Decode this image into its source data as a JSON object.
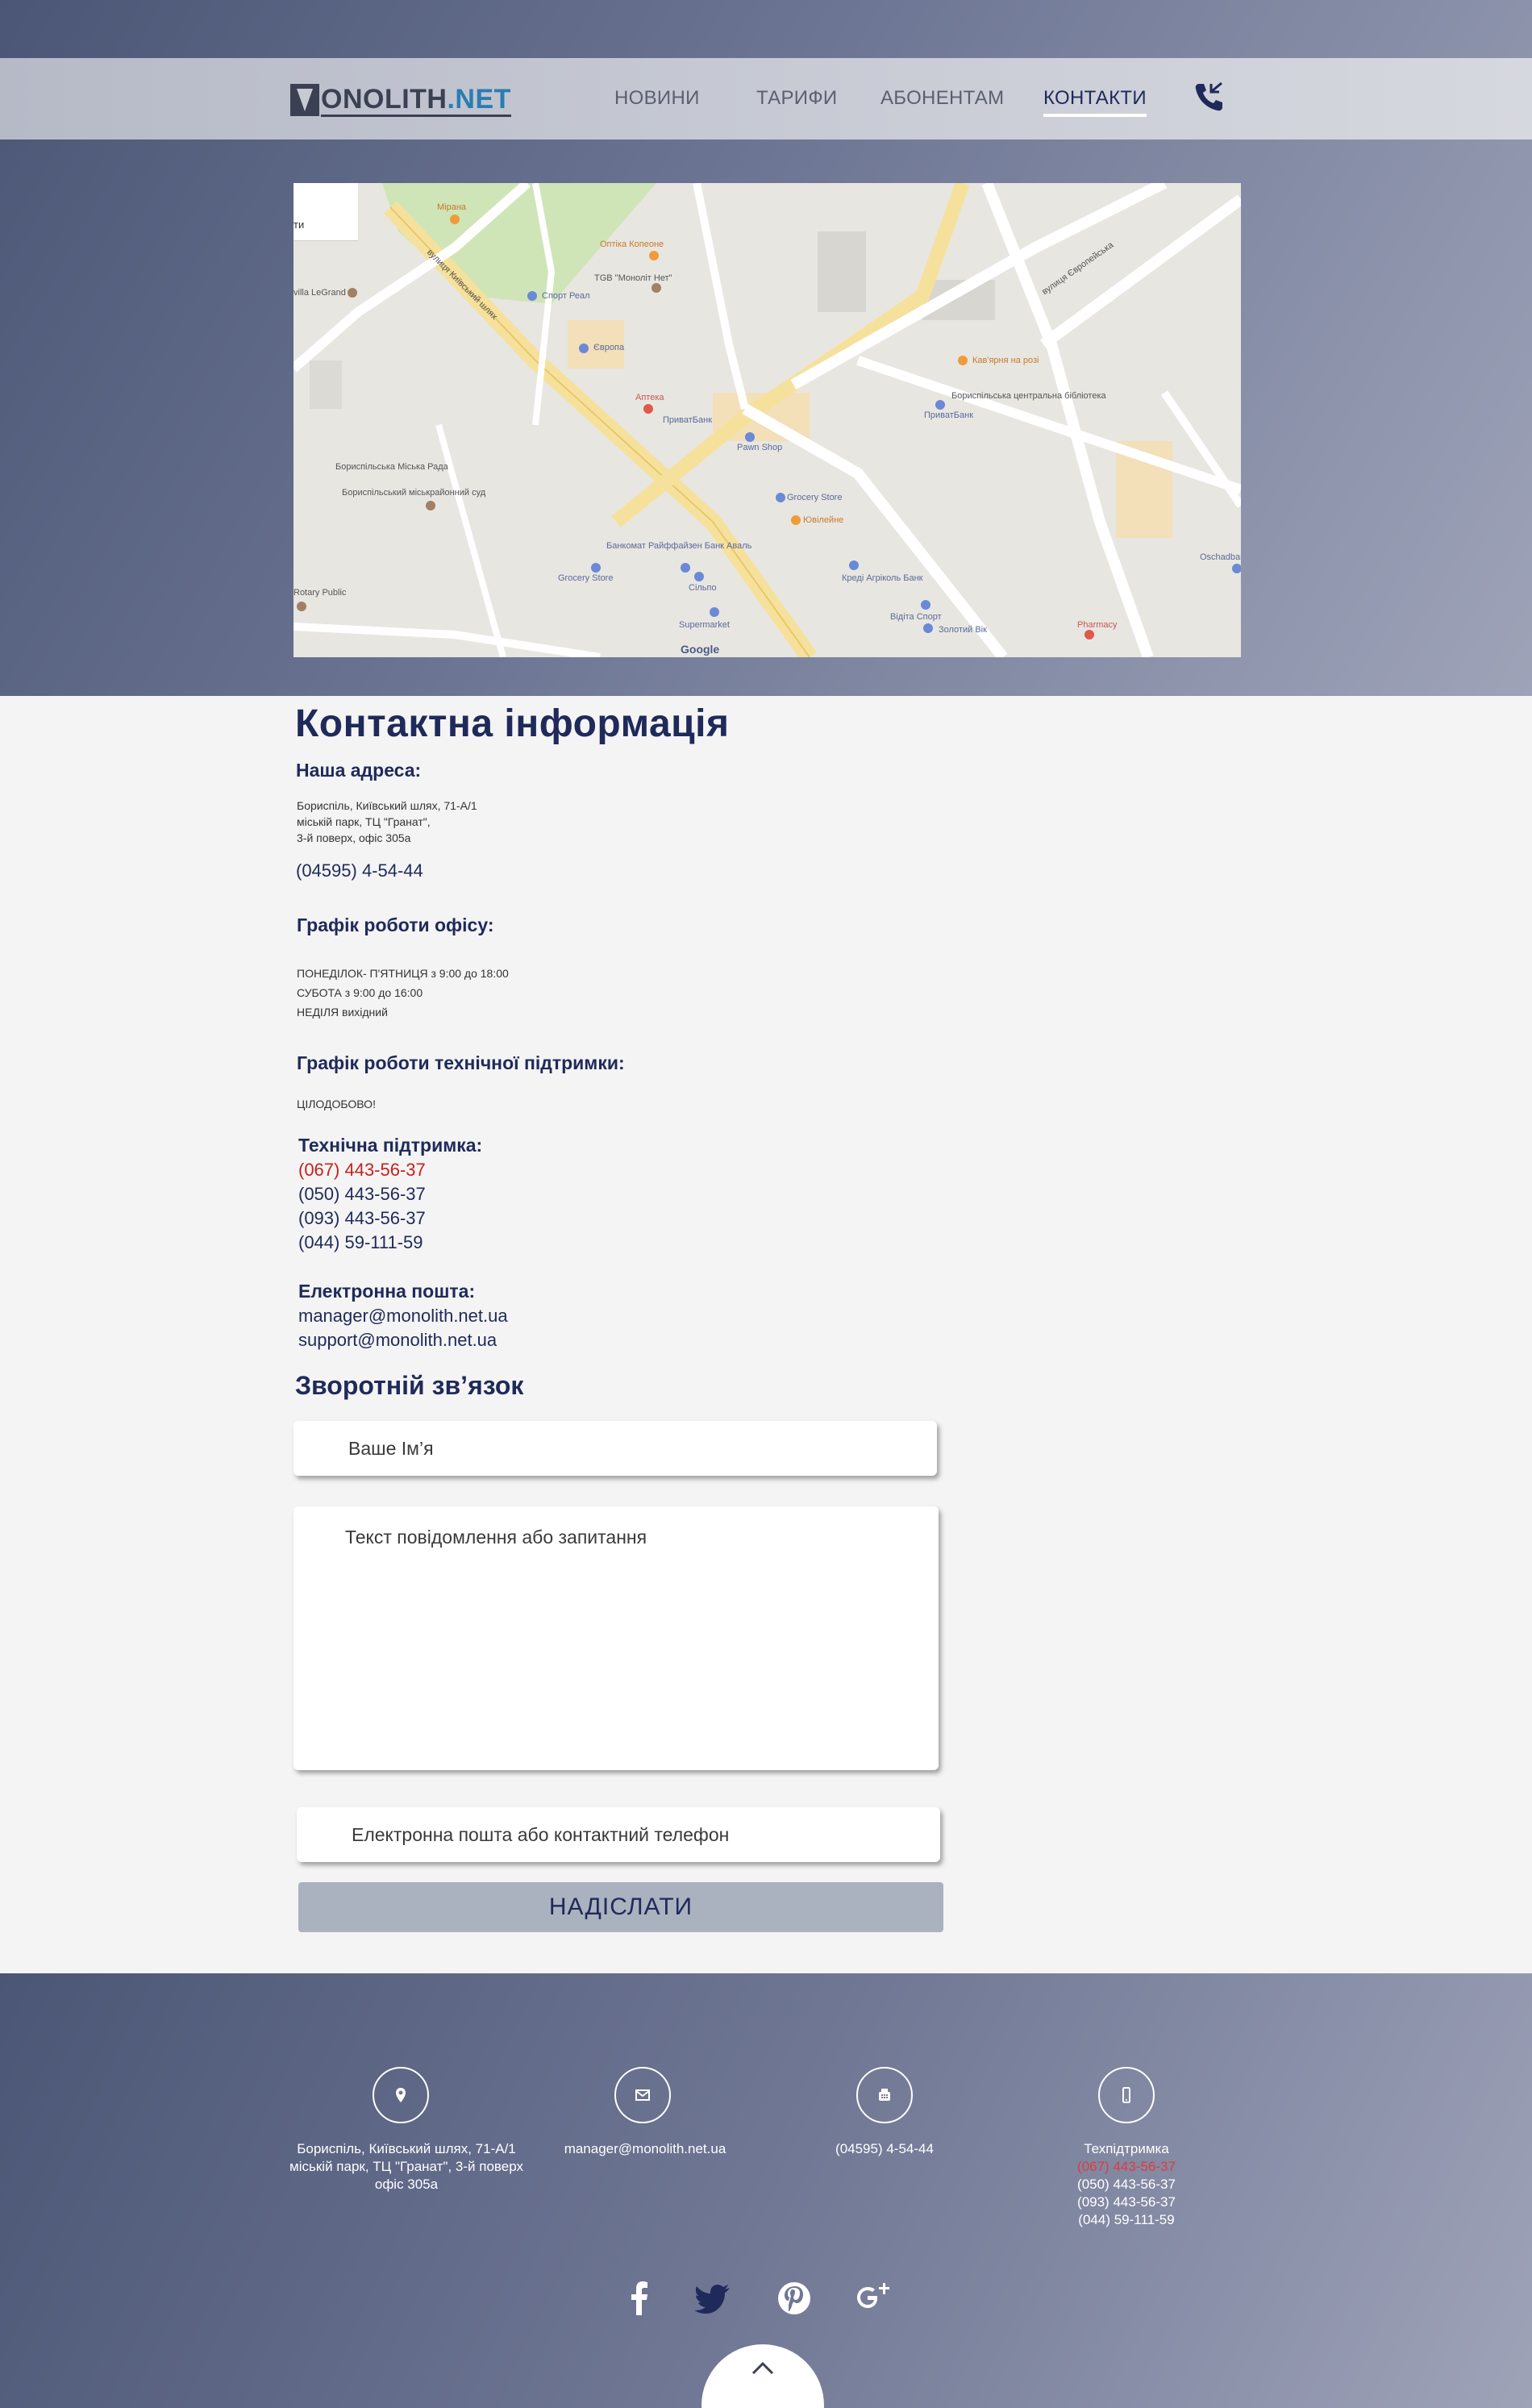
{
  "header": {
    "logo_prefix": "ONOLITH",
    "logo_suffix": ".NET",
    "nav": [
      {
        "label": "НОВИНИ"
      },
      {
        "label": "ТАРИФИ"
      },
      {
        "label": "АБОНЕНТАМ"
      },
      {
        "label": "КОНТАКТИ",
        "active": true
      }
    ]
  },
  "map": {
    "zoom_text": "ти",
    "labels": [
      "Мірана",
      "Оптіка Копеоне",
      "TGB \"Моноліт Нет\"",
      "Спорт Реал",
      "Європа",
      "Аптека",
      "ПриватБанк",
      "Pawn Shop",
      "Grocery Store",
      "Ювілейне",
      "Кав'ярня на розі",
      "Бориспільська центральна бібліотека",
      "ПриватБанк",
      "Бориспільська Міська Рада",
      "Бориспільський міськрайонний суд",
      "Банкомат Райффайзен Банк Аваль",
      "Grocery Store",
      "Сільпо",
      "Supermarket",
      "Креді Агріколь Банк",
      "Відіта Спорт",
      "Золотий Вік",
      "Pharmacy",
      "Oschadbank",
      "villa LeGrand",
      "Rotary Public",
      "вулиця Київський шлях",
      "вулиця Європейська"
    ],
    "attribution": "Google"
  },
  "contact": {
    "title": "Контактна інформація",
    "address_heading": "Наша адреса:",
    "address_lines": [
      "Бориспіль, Київський шлях, 71-А/1",
      "міській парк, ТЦ \"Гранат\",",
      "3-й поверх, офіс 305а"
    ],
    "office_phone": "(04595) 4-54-44",
    "office_hours_heading": "Графік роботи офісу:",
    "office_hours": [
      "ПОНЕДІЛОК- П'ЯТНИЦЯ з 9:00 до 18:00",
      "СУБОТА з 9:00 до 16:00",
      "НЕДІЛЯ вихідний"
    ],
    "support_hours_heading": "Графік роботи технічної підтримки:",
    "support_hours": "ЦІЛОДОБОВО!",
    "support_heading": "Технічна підтримка:",
    "support_phones": [
      " (067) 443-56-37",
      "(050) 443-56-37",
      "(093) 443-56-37",
      "(044) 59-111-59"
    ],
    "email_heading": "Електронна пошта:",
    "emails": [
      "manager@monolith.net.ua",
      "support@monolith.net.ua"
    ]
  },
  "feedback": {
    "title": "Зворотній зв’язок",
    "name_placeholder": "Ваше Ім’я",
    "message_placeholder": "Текст повідомлення або запитання",
    "contact_placeholder": "Електронна пошта або контактний телефон",
    "submit_label": "НАДІСЛАТИ"
  },
  "footer": {
    "address_lines": [
      "Бориспіль, Київський шлях, 71-А/1",
      "міській парк, ТЦ \"Гранат\", 3-й поверх",
      "офіс 305а"
    ],
    "email": "manager@monolith.net.ua",
    "phone": "(04595) 4-54-44",
    "support_label": "Техпідтримка",
    "support_phones": [
      "(067) 443-56-37",
      "(050) 443-56-37",
      "(093) 443-56-37",
      "(044) 59-111-59"
    ]
  },
  "colors": {
    "brand_navy": "#1f2a5a",
    "accent_red": "#c8201e",
    "logo_blue": "#2a7db3"
  }
}
